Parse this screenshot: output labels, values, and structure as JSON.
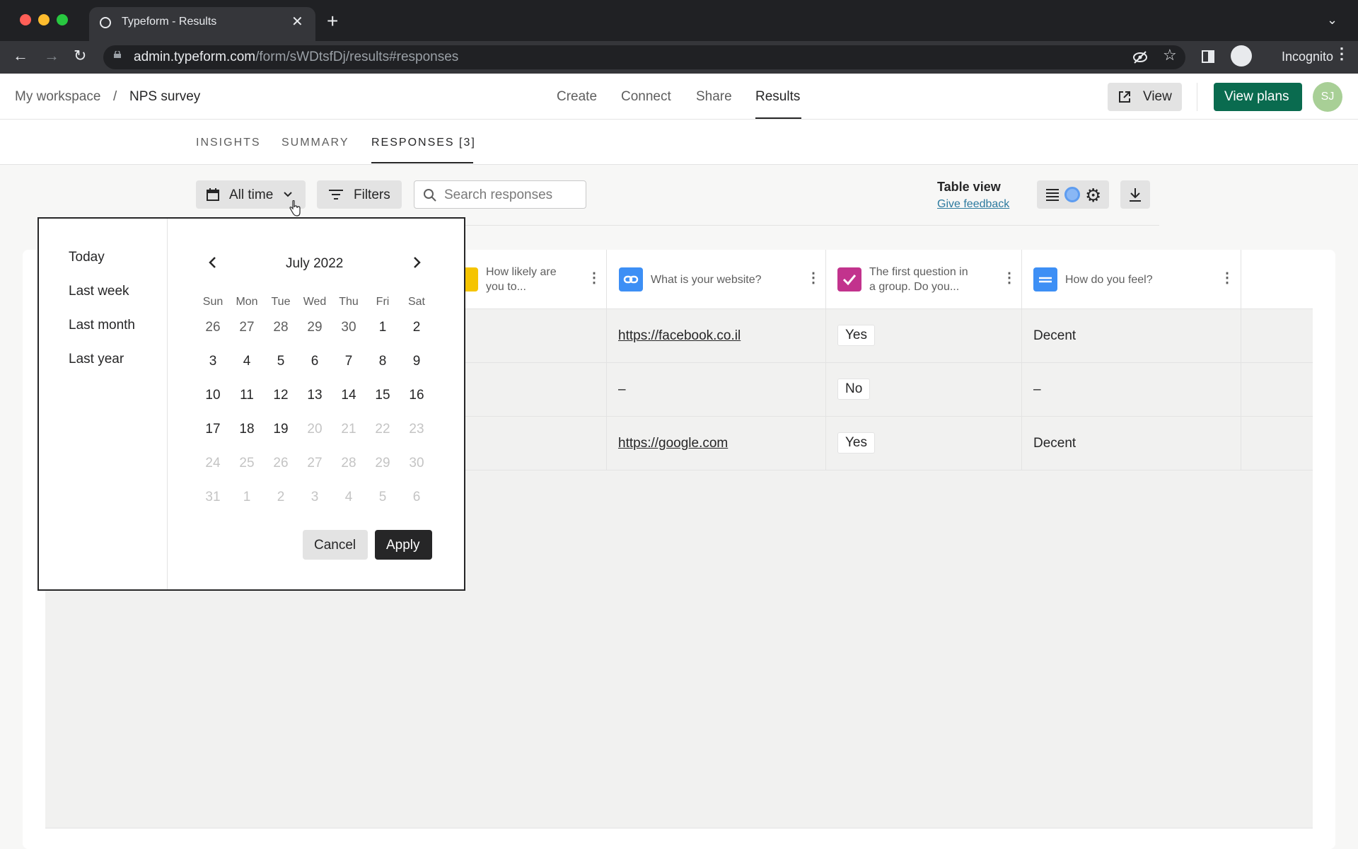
{
  "browser": {
    "tab_title": "Typeform - Results",
    "url_host": "admin.typeform.com",
    "url_path": "/form/sWDtsfDj/results#responses",
    "profile_label": "Incognito"
  },
  "header": {
    "breadcrumb_workspace": "My workspace",
    "breadcrumb_sep": "/",
    "breadcrumb_form": "NPS survey",
    "nav": [
      "Create",
      "Connect",
      "Share",
      "Results"
    ],
    "view_label": "View",
    "plans_label": "View plans",
    "avatar_initials": "SJ"
  },
  "subtabs": [
    "INSIGHTS",
    "SUMMARY",
    "RESPONSES [3]"
  ],
  "controls": {
    "date_range_label": "All time",
    "filters_label": "Filters",
    "search_placeholder": "Search responses",
    "table_view_label": "Table view",
    "feedback_label": "Give feedback"
  },
  "table": {
    "columns": [
      {
        "line1": "How likely are",
        "line2": "you to...",
        "icon": "rating-icon",
        "color": "#f5c400"
      },
      {
        "line1": "What is your website?",
        "line2": "",
        "icon": "link-icon",
        "color": "#3d8ff5"
      },
      {
        "line1": "The first question in",
        "line2": "a group. Do you...",
        "icon": "check-icon",
        "color": "#c2338d"
      },
      {
        "line1": "How do you feel?",
        "line2": "",
        "icon": "dropdown-icon",
        "color": "#3d8ff5"
      }
    ],
    "rows": [
      {
        "website": "https://facebook.co.il",
        "answer": "Yes",
        "feel": "Decent"
      },
      {
        "website": "–",
        "answer": "No",
        "feel": "–"
      },
      {
        "website": "https://google.com",
        "answer": "Yes",
        "feel": "Decent"
      }
    ]
  },
  "datepicker": {
    "presets": [
      "Today",
      "Last week",
      "Last month",
      "Last year"
    ],
    "month_title": "July 2022",
    "weekdays": [
      "Sun",
      "Mon",
      "Tue",
      "Wed",
      "Thu",
      "Fri",
      "Sat"
    ],
    "weeks": [
      [
        "26",
        "27",
        "28",
        "29",
        "30",
        "1",
        "2"
      ],
      [
        "3",
        "4",
        "5",
        "6",
        "7",
        "8",
        "9"
      ],
      [
        "10",
        "11",
        "12",
        "13",
        "14",
        "15",
        "16"
      ],
      [
        "17",
        "18",
        "19",
        "20",
        "21",
        "22",
        "23"
      ],
      [
        "24",
        "25",
        "26",
        "27",
        "28",
        "29",
        "30"
      ],
      [
        "31",
        "1",
        "2",
        "3",
        "4",
        "5",
        "6"
      ]
    ],
    "cancel_label": "Cancel",
    "apply_label": "Apply"
  }
}
